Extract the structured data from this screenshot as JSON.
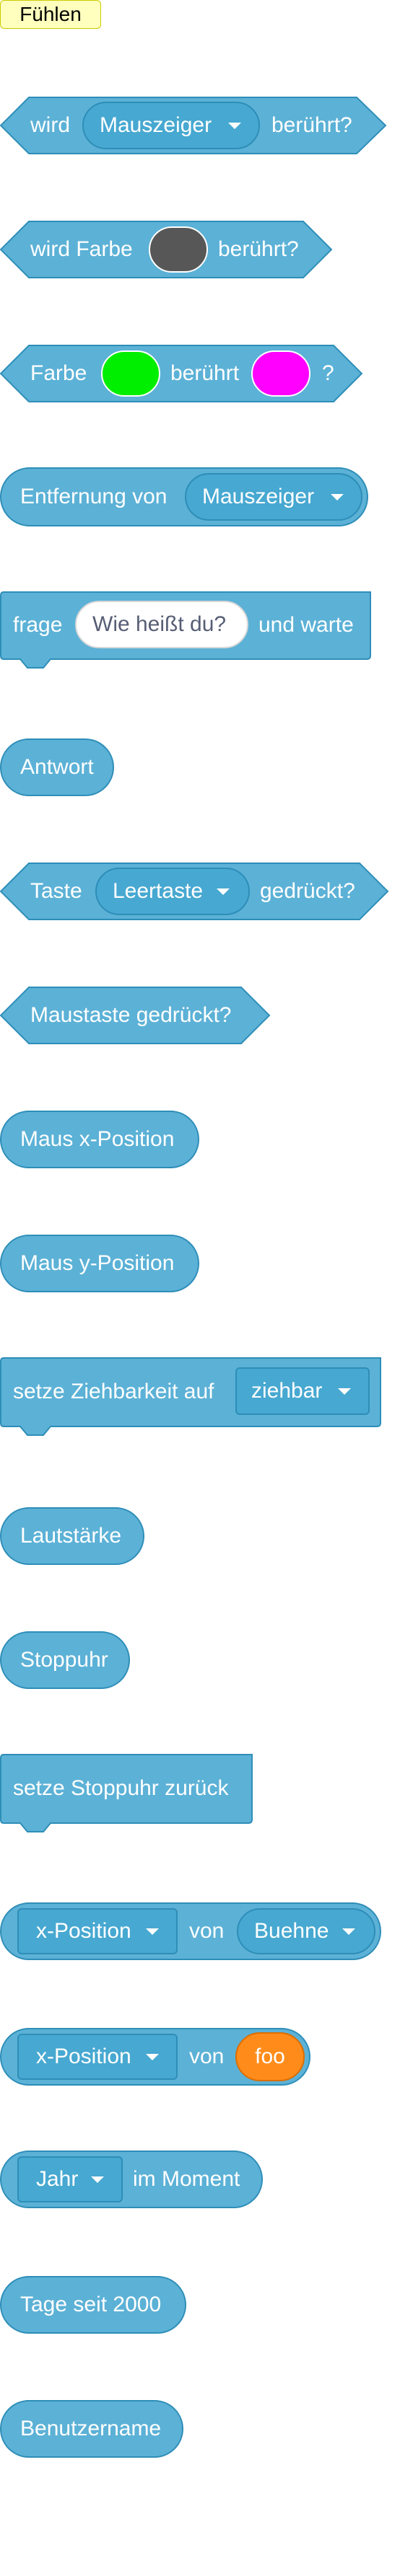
{
  "category": {
    "label": "Fühlen"
  },
  "blocks": {
    "touching": {
      "prefix": "wird",
      "menu": "Mauszeiger",
      "suffix": "berührt?"
    },
    "touching_color": {
      "prefix": "wird Farbe",
      "suffix": "berührt?",
      "color": "#575757"
    },
    "color_touching_color": {
      "prefix": "Farbe",
      "middle": "berührt",
      "suffix": "?",
      "color1": "#00ee00",
      "color2": "#ff00ff"
    },
    "distance": {
      "prefix": "Entfernung von",
      "menu": "Mauszeiger"
    },
    "ask": {
      "prefix": "frage",
      "input": "Wie heißt du?",
      "suffix": "und warte"
    },
    "answer": {
      "label": "Antwort"
    },
    "key_pressed": {
      "prefix": "Taste",
      "menu": "Leertaste",
      "suffix": "gedrückt?"
    },
    "mouse_down": {
      "label": "Maustaste gedrückt?"
    },
    "mouse_x": {
      "label": "Maus x-Position"
    },
    "mouse_y": {
      "label": "Maus y-Position"
    },
    "drag_mode": {
      "prefix": "setze Ziehbarkeit auf",
      "menu": "ziehbar"
    },
    "loudness": {
      "label": "Lautstärke"
    },
    "timer": {
      "label": "Stoppuhr"
    },
    "reset_timer": {
      "label": "setze Stoppuhr zurück"
    },
    "of_sprite": {
      "menu1": "x-Position",
      "middle": "von",
      "menu2": "Buehne"
    },
    "of_var": {
      "menu1": "x-Position",
      "middle": "von",
      "value": "foo"
    },
    "current": {
      "menu": "Jahr",
      "suffix": "im Moment"
    },
    "days_since": {
      "label": "Tage seit 2000"
    },
    "username": {
      "label": "Benutzername"
    }
  },
  "colors": {
    "block_fill": "#5cb1d6",
    "block_stroke": "#2e8eb8",
    "menu_fill": "#47a8d1",
    "category_label_bg": "#ffffbe",
    "reporter_orange": "#ff8c1a"
  }
}
